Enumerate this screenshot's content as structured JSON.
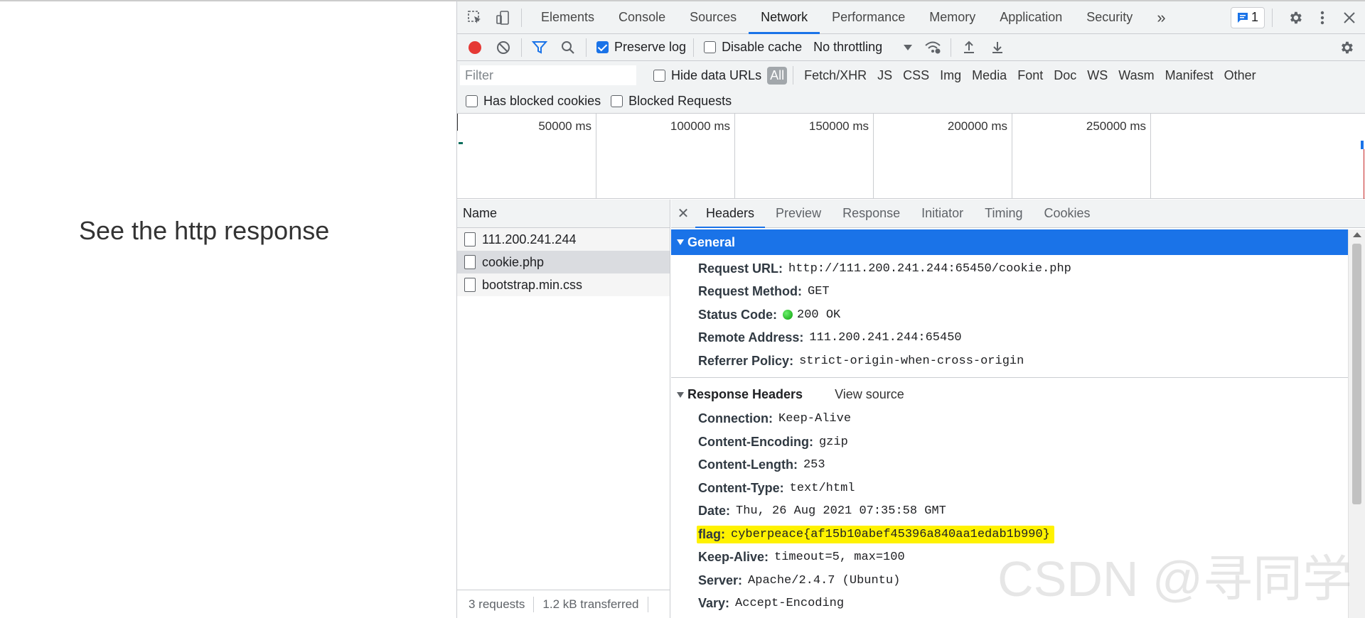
{
  "page": {
    "text": "See the http response"
  },
  "devtools": {
    "main_tabs": [
      "Elements",
      "Console",
      "Sources",
      "Network",
      "Performance",
      "Memory",
      "Application",
      "Security"
    ],
    "active_tab": "Network",
    "more_tabs": "»",
    "message_count": "1",
    "toolbar": {
      "preserve_log": "Preserve log",
      "disable_cache": "Disable cache",
      "throttling": "No throttling"
    },
    "filter": {
      "placeholder": "Filter",
      "hide_data_urls": "Hide data URLs",
      "types": [
        "All",
        "Fetch/XHR",
        "JS",
        "CSS",
        "Img",
        "Media",
        "Font",
        "Doc",
        "WS",
        "Wasm",
        "Manifest",
        "Other"
      ],
      "has_blocked_cookies": "Has blocked cookies",
      "blocked_requests": "Blocked Requests"
    },
    "timeline": {
      "ticks": [
        "50000 ms",
        "100000 ms",
        "150000 ms",
        "200000 ms",
        "250000 ms"
      ]
    },
    "requests": {
      "header": "Name",
      "items": [
        "111.200.241.244",
        "cookie.php",
        "bootstrap.min.css"
      ],
      "selected": "cookie.php",
      "summary_requests": "3 requests",
      "summary_transferred": "1.2 kB transferred"
    },
    "detail_tabs": [
      "Headers",
      "Preview",
      "Response",
      "Initiator",
      "Timing",
      "Cookies"
    ],
    "general": {
      "title": "General",
      "rows": [
        {
          "k": "Request URL:",
          "v": "http://111.200.241.244:65450/cookie.php"
        },
        {
          "k": "Request Method:",
          "v": "GET"
        },
        {
          "k": "Status Code:",
          "v": "200 OK"
        },
        {
          "k": "Remote Address:",
          "v": "111.200.241.244:65450"
        },
        {
          "k": "Referrer Policy:",
          "v": "strict-origin-when-cross-origin"
        }
      ]
    },
    "response_headers": {
      "title": "Response Headers",
      "view_source": "View source",
      "rows": [
        {
          "k": "Connection:",
          "v": "Keep-Alive"
        },
        {
          "k": "Content-Encoding:",
          "v": "gzip"
        },
        {
          "k": "Content-Length:",
          "v": "253"
        },
        {
          "k": "Content-Type:",
          "v": "text/html"
        },
        {
          "k": "Date:",
          "v": "Thu, 26 Aug 2021 07:35:58 GMT"
        },
        {
          "k": "flag:",
          "v": "cyberpeace{af15b10abef45396a840aa1edab1b990}"
        },
        {
          "k": "Keep-Alive:",
          "v": "timeout=5, max=100"
        },
        {
          "k": "Server:",
          "v": "Apache/2.4.7 (Ubuntu)"
        },
        {
          "k": "Vary:",
          "v": "Accept-Encoding"
        }
      ]
    }
  },
  "watermark": "CSDN @寻同学",
  "colors": {
    "accent": "#1a73e8",
    "highlight": "#fff200",
    "record": "#e53935"
  }
}
